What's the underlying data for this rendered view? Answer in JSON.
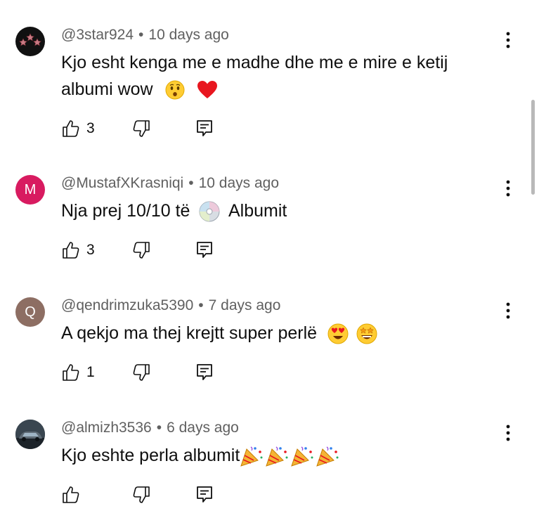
{
  "comments": [
    {
      "author": "@3star924",
      "time": "10 days ago",
      "text_line1": "Kjo esht kenga me e madhe dhe me e mire e ketij",
      "text_line2": "albumi wow",
      "likes": "3",
      "avatar_color": "#111111",
      "avatar_icon": "three-stars-logo"
    },
    {
      "author": "@MustafXKrasniqi",
      "time": "10 days ago",
      "text_before": "Nja prej 10/10 të",
      "text_after": "Albumit",
      "likes": "3",
      "avatar_letter": "M",
      "avatar_color": "#d81b60"
    },
    {
      "author": "@qendrimzuka5390",
      "time": "7 days ago",
      "text": "A qekjo ma thej krejtt super perlë",
      "likes": "1",
      "avatar_letter": "Q",
      "avatar_color": "#8d6e63"
    },
    {
      "author": "@almizh3536",
      "time": "6 days ago",
      "text": "Kjo eshte perla albumit",
      "likes": "",
      "avatar_color": "#263238",
      "avatar_icon": "car-photo"
    }
  ],
  "icons": {
    "like": "thumbs-up-icon",
    "dislike": "thumbs-down-icon",
    "reply": "reply-comment-icon",
    "more": "more-vertical-icon"
  },
  "separator": "•"
}
